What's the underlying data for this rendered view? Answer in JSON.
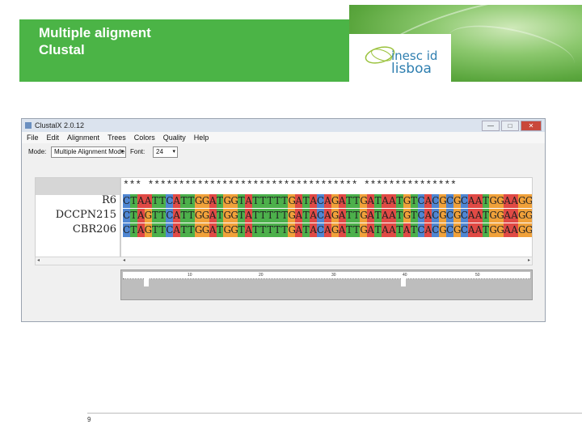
{
  "slide": {
    "title_line1": "Multiple aligment",
    "title_line2": "Clustal",
    "page_number": "9",
    "logo": {
      "line1": "inesc id",
      "line2": "lisboa"
    }
  },
  "app": {
    "title": "ClustalX 2.0.12",
    "window_buttons": [
      "—",
      "□",
      "✕"
    ],
    "menu": [
      "File",
      "Edit",
      "Alignment",
      "Trees",
      "Colors",
      "Quality",
      "Help"
    ],
    "mode_label": "Mode:",
    "mode_value": "Multiple Alignment Mode",
    "font_label": "Font:",
    "font_value": "24",
    "consensus": "*** ********************************** ***************",
    "sequences": [
      {
        "name": "R6",
        "seq": "CTAATTCATTGGATGGTATTTTTGATACAGATTGATAATGTCACGCGCAATGGAAGG"
      },
      {
        "name": "DCCPN215",
        "seq": "CTAGTTCATTGGATGGTATTTTTGATACAGATTGATAATGTCACGCGCAATGGAAGG"
      },
      {
        "name": "CBR206",
        "seq": "CTAGTTCATTGGATGGTATTTTTGATACAGATTGATAATATCACGCGCAATGGAAGG"
      }
    ],
    "ruler_marks": [
      "10",
      "20",
      "30",
      "40",
      "50"
    ],
    "colors": {
      "A": "#e04a45",
      "C": "#4f86d2",
      "G": "#f0a13a",
      "T": "#4cb04b",
      "brand_green": "#4bb446"
    }
  }
}
